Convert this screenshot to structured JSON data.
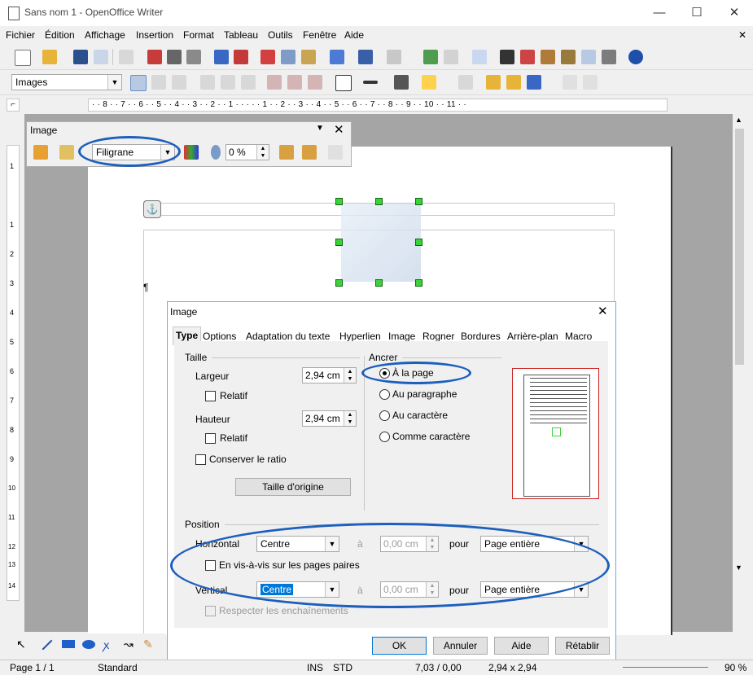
{
  "window": {
    "title": "Sans nom 1 - OpenOffice Writer",
    "minimize": "—",
    "maximize": "☐",
    "close": "✕",
    "doc_close": "✕"
  },
  "menu": [
    "Fichier",
    "Édition",
    "Affichage",
    "Insertion",
    "Format",
    "Tableau",
    "Outils",
    "Fenêtre",
    "Aide"
  ],
  "format_toolbar": {
    "style_value": "Images"
  },
  "ruler": {
    "h_ticks": "· · 8 · · 7 · · 6 · · 5 · · 4 · · 3 · · 2 · · 1 · · · · · 1 · · 2 · · 3 · · 4 · · 5 · · 6 · · 7 · · 8 · · 9 · · 10 · · 11 · ·",
    "v_ticks": [
      "1",
      "1",
      "2",
      "3",
      "4",
      "5",
      "6",
      "7",
      "8",
      "9",
      "10",
      "11",
      "12",
      "13",
      "14"
    ]
  },
  "image_toolbar": {
    "title": "Image",
    "filter_value": "Filigrane",
    "transparency_value": "0 %"
  },
  "dialog": {
    "title": "Image",
    "tabs": [
      "Type",
      "Options",
      "Adaptation du texte",
      "Hyperlien",
      "Image",
      "Rogner",
      "Bordures",
      "Arrière-plan",
      "Macro"
    ],
    "size": {
      "section": "Taille",
      "width_label": "Largeur",
      "width_value": "2,94 cm",
      "relative_label": "Relatif",
      "height_label": "Hauteur",
      "height_value": "2,94 cm",
      "relative2_label": "Relatif",
      "keep_ratio_label": "Conserver le ratio",
      "original_size_button": "Taille d'origine"
    },
    "anchor": {
      "section": "Ancrer",
      "options": [
        "À la page",
        "Au paragraphe",
        "Au caractère",
        "Comme caractère"
      ],
      "selected": 0
    },
    "position": {
      "section": "Position",
      "horizontal_label": "Horizontal",
      "horizontal_value": "Centre",
      "a_label": "à",
      "horizontal_offset": "0,00 cm",
      "pour_label": "pour",
      "horizontal_ref": "Page entière",
      "mirror_label": "En vis-à-vis sur les pages paires",
      "vertical_label": "Vertical",
      "vertical_value": "Centre",
      "a2_label": "à",
      "vertical_offset": "0,00 cm",
      "pour2_label": "pour",
      "vertical_ref": "Page entière",
      "follow_label": "Respecter les enchaînements"
    },
    "buttons": {
      "ok": "OK",
      "cancel": "Annuler",
      "help": "Aide",
      "reset": "Rétablir"
    }
  },
  "status": {
    "page": "Page 1 / 1",
    "style": "Standard",
    "ins": "INS",
    "std": "STD",
    "pos": "7,03 / 0,00",
    "size": "2,94 x 2,94",
    "zoom": "90 %"
  },
  "colors": {
    "highlight": "#1c5fbd",
    "handle": "#39d339",
    "preview_frame": "#cc2222"
  }
}
